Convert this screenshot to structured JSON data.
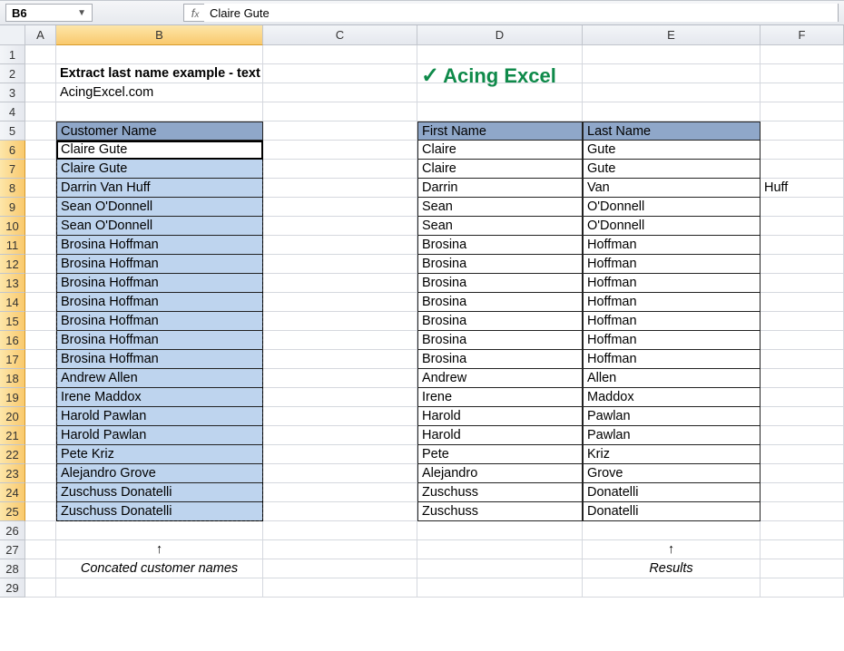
{
  "active_cell_ref": "B6",
  "formula_bar_value": "Claire Gute",
  "col_labels": [
    "A",
    "B",
    "C",
    "D",
    "E",
    "F"
  ],
  "row_labels": [
    "1",
    "2",
    "3",
    "4",
    "5",
    "6",
    "7",
    "8",
    "9",
    "10",
    "11",
    "12",
    "13",
    "14",
    "15",
    "16",
    "17",
    "18",
    "19",
    "20",
    "21",
    "22",
    "23",
    "24",
    "25",
    "26",
    "27",
    "28",
    "29"
  ],
  "title": "Extract last name example - text to columns",
  "subtitle": "AcingExcel.com",
  "logo_text": "Acing Excel",
  "tableB_header": "Customer Name",
  "tableD_header": "First Name",
  "tableE_header": "Last Name",
  "footer_left": "Concated customer names",
  "footer_right": "Results",
  "arrow": "↑",
  "overflow_F8": "Huff",
  "rows": [
    {
      "b": "Claire Gute",
      "d": "Claire",
      "e": "Gute"
    },
    {
      "b": "Claire Gute",
      "d": "Claire",
      "e": "Gute"
    },
    {
      "b": "Darrin Van Huff",
      "d": "Darrin",
      "e": "Van"
    },
    {
      "b": "Sean O'Donnell",
      "d": "Sean",
      "e": "O'Donnell"
    },
    {
      "b": "Sean O'Donnell",
      "d": "Sean",
      "e": "O'Donnell"
    },
    {
      "b": "Brosina Hoffman",
      "d": "Brosina",
      "e": "Hoffman"
    },
    {
      "b": "Brosina Hoffman",
      "d": "Brosina",
      "e": "Hoffman"
    },
    {
      "b": "Brosina Hoffman",
      "d": "Brosina",
      "e": "Hoffman"
    },
    {
      "b": "Brosina Hoffman",
      "d": "Brosina",
      "e": "Hoffman"
    },
    {
      "b": "Brosina Hoffman",
      "d": "Brosina",
      "e": "Hoffman"
    },
    {
      "b": "Brosina Hoffman",
      "d": "Brosina",
      "e": "Hoffman"
    },
    {
      "b": "Brosina Hoffman",
      "d": "Brosina",
      "e": "Hoffman"
    },
    {
      "b": "Andrew Allen",
      "d": "Andrew",
      "e": "Allen"
    },
    {
      "b": "Irene Maddox",
      "d": "Irene",
      "e": "Maddox"
    },
    {
      "b": "Harold Pawlan",
      "d": "Harold",
      "e": "Pawlan"
    },
    {
      "b": "Harold Pawlan",
      "d": "Harold",
      "e": "Pawlan"
    },
    {
      "b": "Pete Kriz",
      "d": "Pete",
      "e": "Kriz"
    },
    {
      "b": "Alejandro Grove",
      "d": "Alejandro",
      "e": "Grove"
    },
    {
      "b": "Zuschuss Donatelli",
      "d": "Zuschuss",
      "e": "Donatelli"
    },
    {
      "b": "Zuschuss Donatelli",
      "d": "Zuschuss",
      "e": "Donatelli"
    }
  ]
}
